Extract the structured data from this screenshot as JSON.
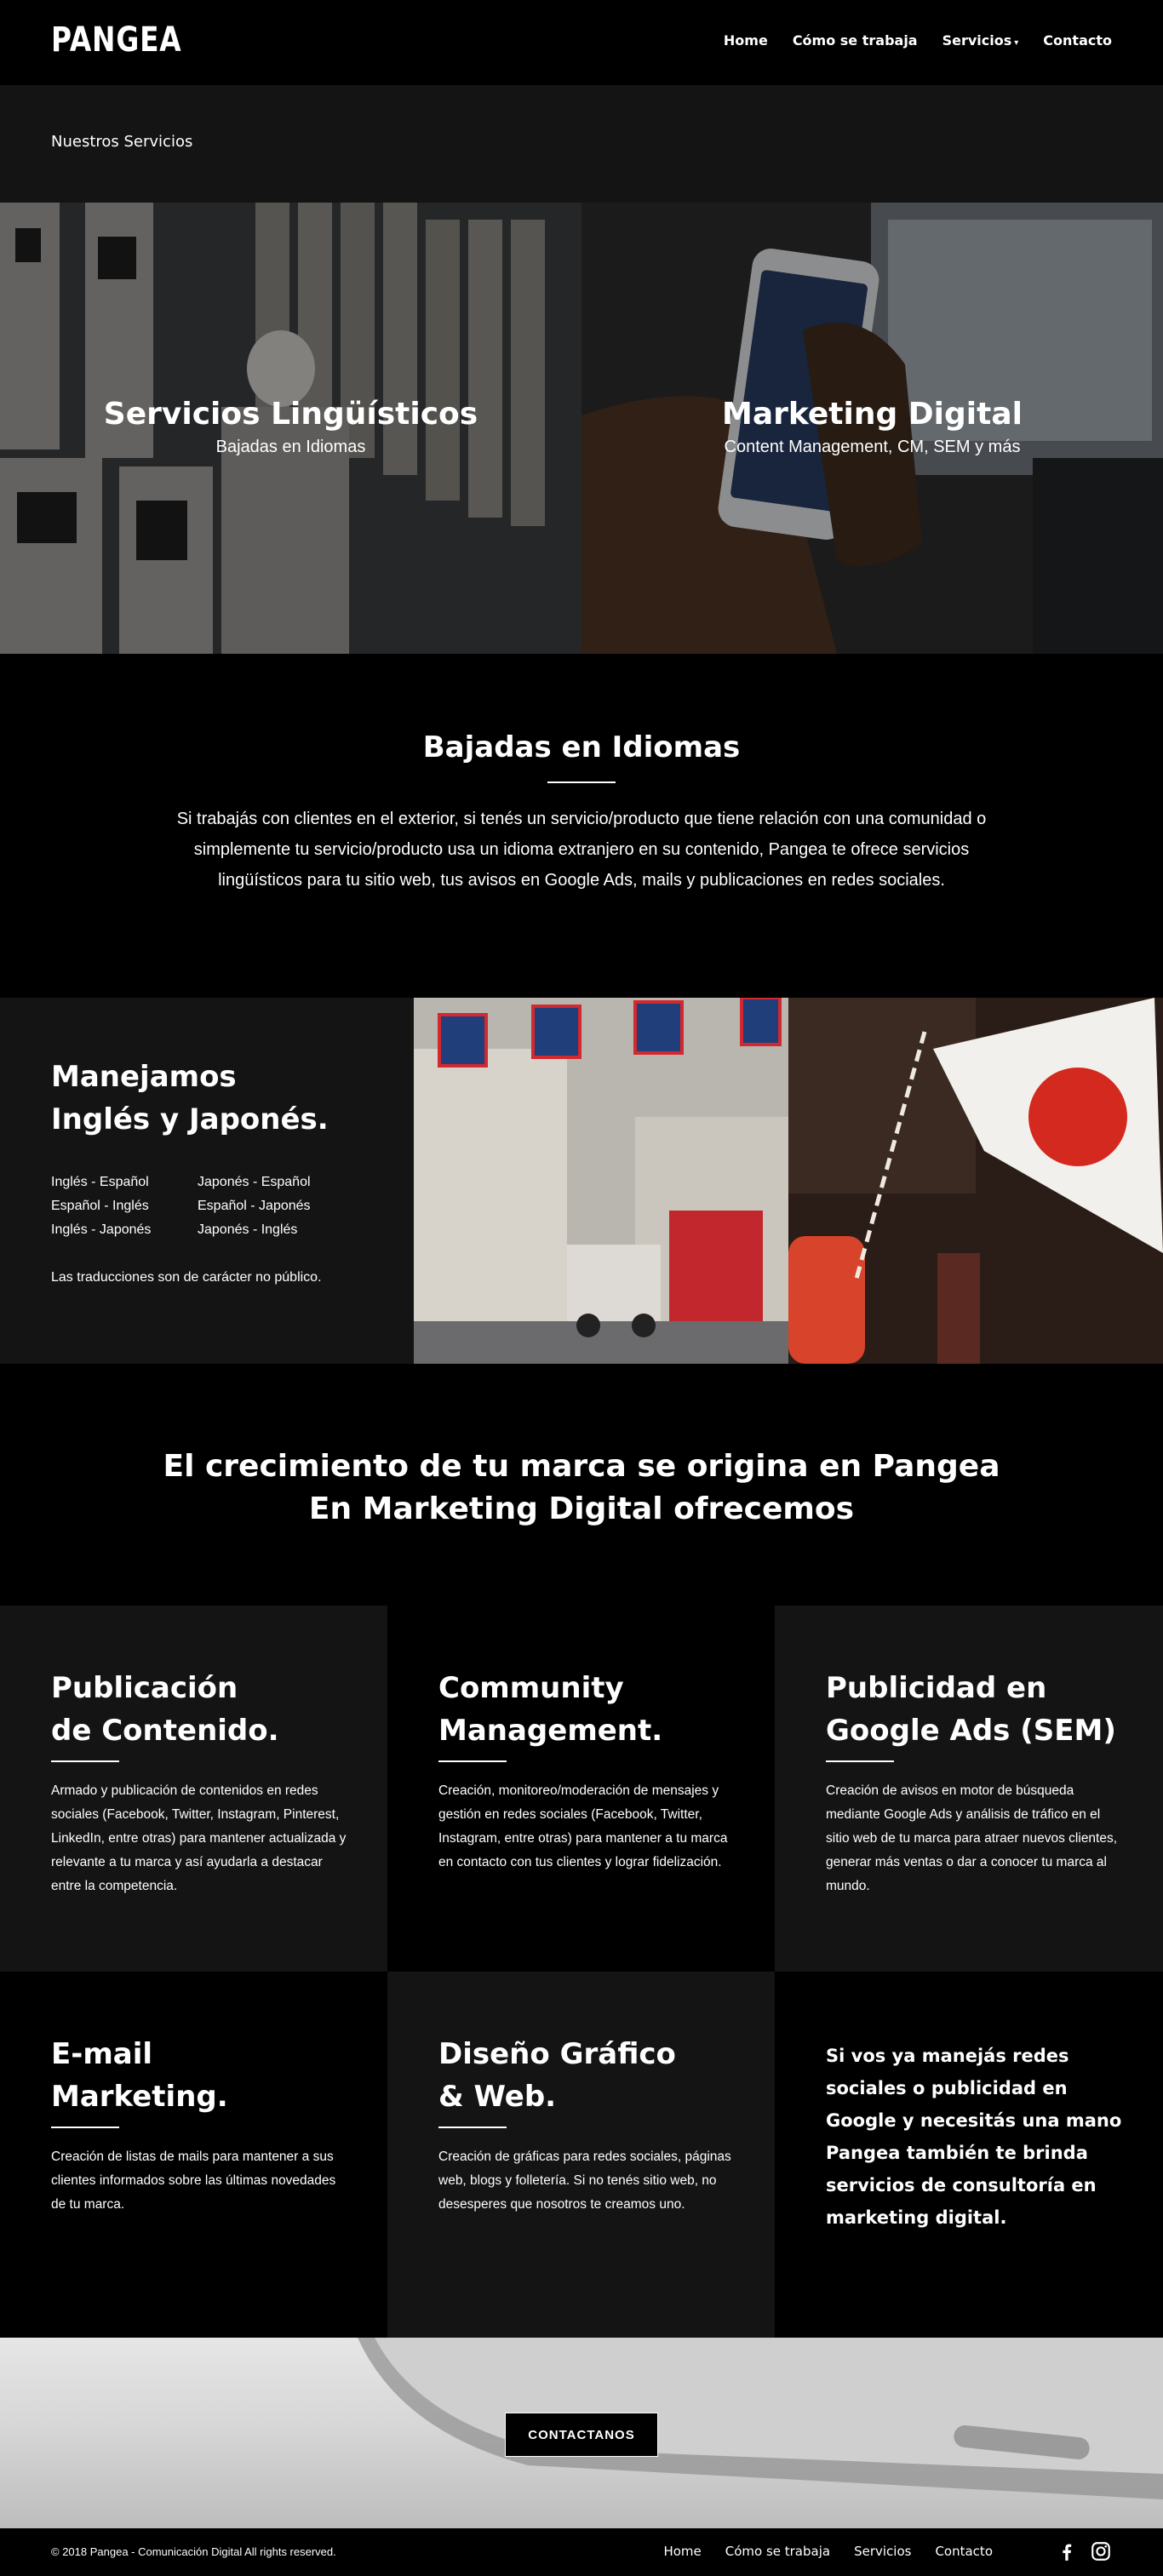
{
  "header": {
    "logo": "PANGEA",
    "nav": [
      "Home",
      "Cómo se trabaja",
      "Servicios",
      "Contacto"
    ]
  },
  "title_bar": {
    "title": "Nuestros Servicios"
  },
  "hero": {
    "left": {
      "title": "Servicios Lingüísticos",
      "subtitle": "Bajadas en Idiomas"
    },
    "right": {
      "title": "Marketing Digital",
      "subtitle": "Content Management, CM, SEM y más"
    }
  },
  "bajadas": {
    "title": "Bajadas en Idiomas",
    "text": "Si trabajás con clientes en el exterior, si tenés un servicio/producto que tiene relación con una comunidad o simplemente tu servicio/producto usa un idioma extranjero en su contenido, Pangea te ofrece servicios lingüísticos para tu sitio web, tus avisos en Google Ads, mails y publicaciones en redes sociales."
  },
  "idiomas": {
    "title_line1": "Manejamos",
    "title_line2": "Inglés y Japonés.",
    "pairs": [
      "Inglés - Español",
      "Japonés - Español",
      "Español - Inglés",
      "Español - Japonés",
      "Inglés - Japonés",
      "Japonés - Inglés"
    ],
    "note": "Las traducciones son de carácter no público."
  },
  "crecimiento": {
    "line1": "El crecimiento de tu marca se origina en Pangea",
    "line2": "En Marketing Digital ofrecemos"
  },
  "services": [
    {
      "title1": "Publicación",
      "title2": "de Contenido.",
      "text": "Armado y publicación de contenidos en redes sociales (Facebook, Twitter, Instagram, Pinterest, LinkedIn, entre otras) para mantener actualizada y relevante a tu marca y así ayudarla a destacar entre la competencia."
    },
    {
      "title1": "Community",
      "title2": "Management.",
      "text": "Creación, monitoreo/moderación de mensajes y gestión en redes sociales (Facebook, Twitter, Instagram, entre otras) para mantener a tu marca en contacto con tus clientes y lograr fidelización."
    },
    {
      "title1": "Publicidad en",
      "title2": "Google Ads (SEM)",
      "text": "Creación de avisos en motor de búsqueda mediante Google Ads y análisis de tráfico en el sitio web de tu marca para atraer nuevos clientes, generar más ventas o dar a conocer tu marca al mundo."
    },
    {
      "title1": "E-mail",
      "title2": "Marketing.",
      "text": "Creación de listas de mails para mantener a sus clientes informados sobre las últimas novedades de tu marca."
    },
    {
      "title1": "Diseño Gráfico",
      "title2": "& Web.",
      "text": "Creación de gráficas para redes sociales, páginas web, blogs y folletería. Si no tenés sitio web, no desesperes que nosotros te creamos uno."
    }
  ],
  "consultoria": "Si vos ya manejás redes sociales o publicidad en Google y necesitás una mano Pangea también te brinda servicios de consultoría en marketing digital.",
  "cta": {
    "button": "CONTACTANOS"
  },
  "footer": {
    "copyright": "© 2018 Pangea - Comunicación Digital All rights reserved.",
    "nav": [
      "Home",
      "Cómo se trabaja",
      "Servicios",
      "Contacto"
    ],
    "icons": [
      "facebook-icon",
      "instagram-icon"
    ]
  }
}
